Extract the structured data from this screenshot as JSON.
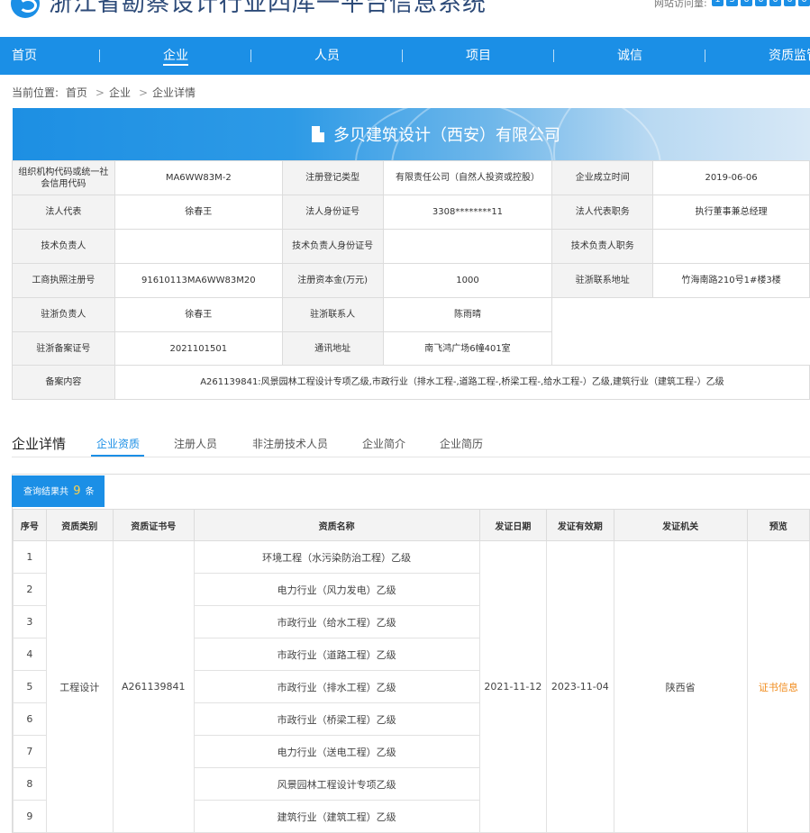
{
  "header": {
    "site_title": "浙江省勘察设计行业四库一平台信息系统",
    "visit_label": "网站访问量:",
    "visit_digits": [
      "1",
      "3",
      "0",
      "0",
      "0",
      "0",
      "0",
      "0"
    ]
  },
  "nav": {
    "items": [
      "首页",
      "企业",
      "人员",
      "项目",
      "诚信",
      "资质监管"
    ],
    "active": "企业"
  },
  "breadcrumb": {
    "label": "当前位置:",
    "items": [
      "首页",
      "企业",
      "企业详情"
    ]
  },
  "company": {
    "name": "多贝建筑设计（西安）有限公司"
  },
  "info": {
    "org_code_label": "组织机构代码或统一社会信用代码",
    "org_code": "MA6WW83M-2",
    "reg_type_label": "注册登记类型",
    "reg_type": "有限责任公司（自然人投资或控股）",
    "founded_label": "企业成立时间",
    "founded": "2019-06-06",
    "legal_rep_label": "法人代表",
    "legal_rep": "徐春王",
    "legal_id_label": "法人身份证号",
    "legal_id": "3308********11",
    "legal_title_label": "法人代表职务",
    "legal_title": "执行董事兼总经理",
    "tech_lead_label": "技术负责人",
    "tech_lead": "",
    "tech_id_label": "技术负责人身份证号",
    "tech_id": "",
    "tech_title_label": "技术负责人职务",
    "tech_title": "",
    "biz_reg_label": "工商执照注册号",
    "biz_reg": "91610113MA6WW83M20",
    "capital_label": "注册资本金(万元)",
    "capital": "1000",
    "zj_addr_label": "驻浙联系地址",
    "zj_addr": "竹海南路210号1#楼3楼",
    "zj_lead_label": "驻浙负责人",
    "zj_lead": "徐春王",
    "zj_contact_label": "驻浙联系人",
    "zj_contact": "陈雨晴",
    "zj_filing_label": "驻浙备案证号",
    "zj_filing": "2021101501",
    "mail_addr_label": "通讯地址",
    "mail_addr": "南飞鸿广场6幢401室",
    "filing_content_label": "备案内容",
    "filing_content": "A261139841:风景园林工程设计专项乙级,市政行业（排水工程-,道路工程-,桥梁工程-,给水工程-）乙级,建筑行业（建筑工程-）乙级"
  },
  "detail": {
    "heading": "企业详情",
    "tabs": [
      "企业资质",
      "注册人员",
      "非注册技术人员",
      "企业简介",
      "企业简历"
    ],
    "active_tab": "企业资质"
  },
  "results": {
    "prefix": "查询结果共",
    "count": "9",
    "suffix": "条",
    "columns": [
      "序号",
      "资质类别",
      "资质证书号",
      "资质名称",
      "发证日期",
      "发证有效期",
      "发证机关",
      "预览"
    ],
    "category": "工程设计",
    "cert_no": "A261139841",
    "issue_date": "2021-11-12",
    "valid_until": "2023-11-04",
    "authority": "陕西省",
    "preview": "证书信息",
    "rows": [
      {
        "no": "1",
        "name": "环境工程（水污染防治工程）乙级"
      },
      {
        "no": "2",
        "name": "电力行业（风力发电）乙级"
      },
      {
        "no": "3",
        "name": "市政行业（给水工程）乙级"
      },
      {
        "no": "4",
        "name": "市政行业（道路工程）乙级"
      },
      {
        "no": "5",
        "name": "市政行业（排水工程）乙级"
      },
      {
        "no": "6",
        "name": "市政行业（桥梁工程）乙级"
      },
      {
        "no": "7",
        "name": "电力行业（送电工程）乙级"
      },
      {
        "no": "8",
        "name": "风景园林工程设计专项乙级"
      },
      {
        "no": "9",
        "name": "建筑行业（建筑工程）乙级"
      }
    ]
  }
}
